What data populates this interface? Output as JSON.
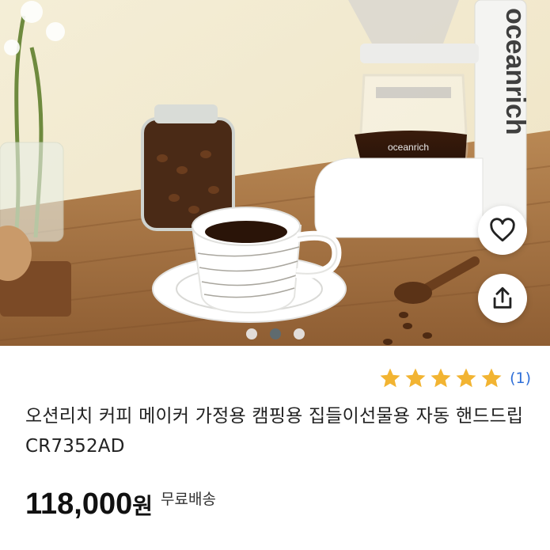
{
  "product": {
    "brand_print": "oceanrich",
    "title": "오션리치 커피 메이커 가정용 캠핑용 집들이선물용 자동 핸드드립 CR7352AD",
    "rating": {
      "stars": 5,
      "count_label": "(1)"
    },
    "price": "118,000",
    "currency": "원",
    "shipping": "무료배송"
  },
  "gallery": {
    "total": 3,
    "active_index": 1
  },
  "actions": {
    "like_icon": "heart-icon",
    "share_icon": "share-icon"
  },
  "colors": {
    "star": "#f2b432",
    "rating_count": "#2f6fd8",
    "active_dot": "#5f6b6f"
  }
}
